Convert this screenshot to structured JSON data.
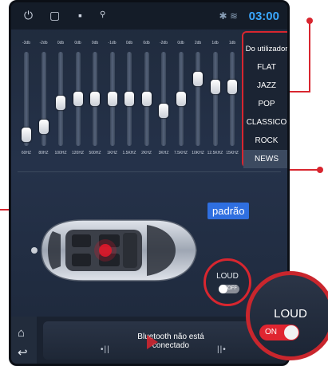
{
  "statusbar": {
    "time": "03:00",
    "icons": [
      "power-icon",
      "recent-apps-icon",
      "gallery-icon",
      "usb-icon",
      "bluetooth-icon",
      "wifi-icon"
    ]
  },
  "equalizer": {
    "bands": [
      {
        "db": "-3db",
        "freq": "60HZ",
        "level": -9
      },
      {
        "db": "-2db",
        "freq": "80HZ",
        "level": -7
      },
      {
        "db": "0db",
        "freq": "100HZ",
        "level": -1
      },
      {
        "db": "0db",
        "freq": "120HZ",
        "level": 0
      },
      {
        "db": "0db",
        "freq": "500HZ",
        "level": 0
      },
      {
        "db": "-1db",
        "freq": "1KHZ",
        "level": 0
      },
      {
        "db": "0db",
        "freq": "1.5KHZ",
        "level": 0
      },
      {
        "db": "0db",
        "freq": "2KHZ",
        "level": 0
      },
      {
        "db": "-2db",
        "freq": "3KHZ",
        "level": -3
      },
      {
        "db": "0db",
        "freq": "7.5KHZ",
        "level": 0
      },
      {
        "db": "2db",
        "freq": "10KHZ",
        "level": 5
      },
      {
        "db": "1db",
        "freq": "12.5KHZ",
        "level": 3
      },
      {
        "db": "1db",
        "freq": "15KHZ",
        "level": 3
      }
    ]
  },
  "presets": {
    "items": [
      "Do utilizador",
      "FLAT",
      "JAZZ",
      "POP",
      "CLASSICO",
      "ROCK",
      "NEWS"
    ],
    "selected": "NEWS"
  },
  "sound_field": {
    "button": "padrão"
  },
  "loud": {
    "label": "LOUD",
    "state_off": "OFF"
  },
  "loud_callout": {
    "label": "LOUD",
    "state_on": "ON"
  },
  "player": {
    "status": "Bluetooth não está conectado"
  },
  "colors": {
    "accent": "#3aa7ff",
    "annotation": "#d8262f",
    "selected_preset_button": "#2f6fe0"
  }
}
